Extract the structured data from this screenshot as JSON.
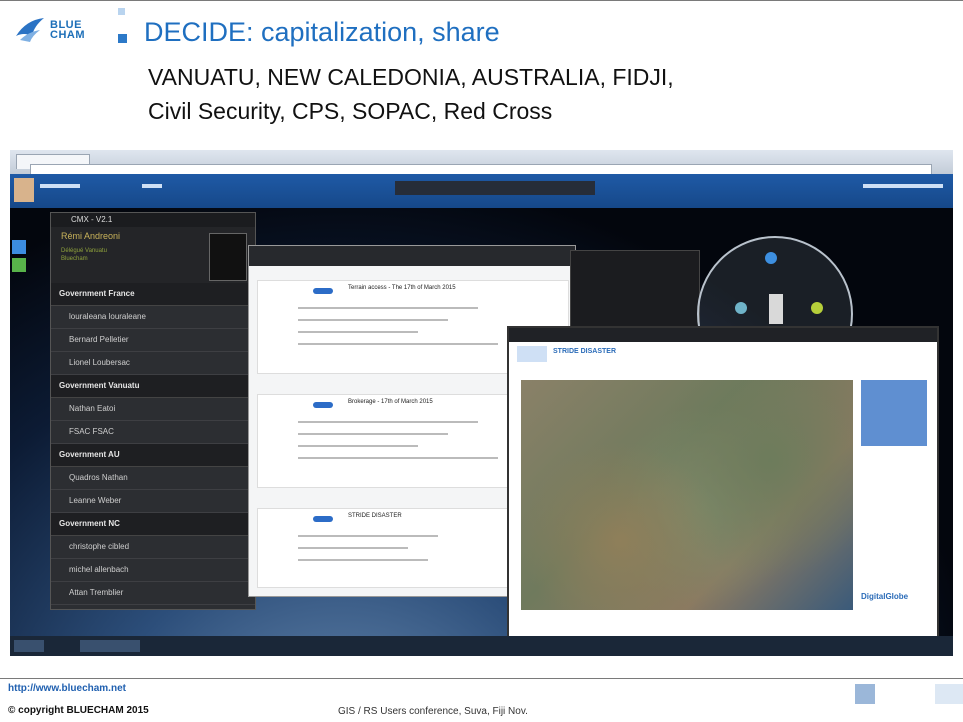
{
  "logo": {
    "text_line1": "BLUE",
    "text_line2": "CHAM"
  },
  "slide": {
    "title": "DECIDE: capitalization, share",
    "subtitle_line1": "VANUATU, NEW CALEDONIA, AUSTRALIA, FIDJI,",
    "subtitle_line2": "Civil Security, CPS, SOPAC, Red Cross"
  },
  "screenshot": {
    "panel": {
      "header": "CMX - V2.1",
      "user_name": "Rémi Andreoni",
      "user_role": "Délégué Vanuatu Bluecham",
      "groups": [
        {
          "name": "Government France",
          "members": [
            "louraleana louraleane",
            "Bernard Pelletier",
            "Lionel Loubersac"
          ]
        },
        {
          "name": "Government Vanuatu",
          "members": [
            "Nathan Eatoi",
            "FSAC FSAC"
          ]
        },
        {
          "name": "Government AU",
          "members": [
            "Quadros Nathan",
            "Leanne Weber"
          ]
        },
        {
          "name": "Government NC",
          "members": [
            "christophe cibled",
            "michel allenbach",
            "Attan Tremblier"
          ]
        }
      ]
    },
    "cards": [
      {
        "title": "Terrain access - The 17th of March 2015"
      },
      {
        "title": "Brokerage - 17th of March 2015"
      },
      {
        "title": "STRIDE DISASTER"
      }
    ],
    "map_window": {
      "title": "STRIDE DISASTER",
      "brand": "DigitalGlobe"
    }
  },
  "footer": {
    "url": "http://www.bluecham.net",
    "copyright": "© copyright BLUECHAM 2015",
    "event": "GIS / RS Users conference, Suva, Fiji Nov."
  },
  "colors": {
    "title": "#1f6fc0",
    "accent": "#2c79c8",
    "app_bar": "#1f5aa6"
  }
}
